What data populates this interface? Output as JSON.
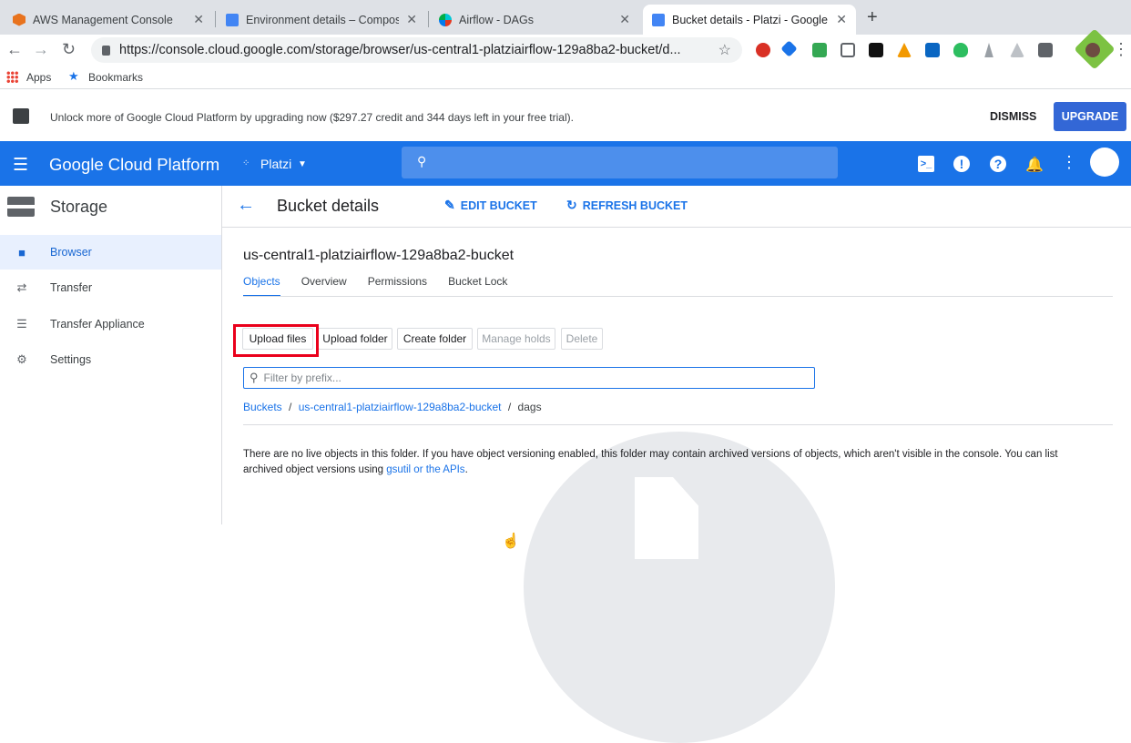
{
  "browser": {
    "tabs": [
      {
        "title": "AWS Management Console"
      },
      {
        "title": "Environment details – Composer"
      },
      {
        "title": "Airflow - DAGs"
      },
      {
        "title": "Bucket details - Platzi - Google Cloud Platform"
      }
    ],
    "url": "https://console.cloud.google.com/storage/browser/us-central1-platziairflow-129a8ba2-bucket/d...",
    "bookmarks": {
      "apps": "Apps",
      "bookmarks": "Bookmarks"
    }
  },
  "banner": {
    "message": "Unlock more of Google Cloud Platform by upgrading now ($297.27 credit and 344 days left in your free trial).",
    "dismiss": "DISMISS",
    "upgrade": "UPGRADE"
  },
  "header": {
    "brand": "Google Cloud Platform",
    "project": "Platzi"
  },
  "sidebar": {
    "title": "Storage",
    "items": [
      {
        "label": "Browser",
        "icon": "bucket-icon"
      },
      {
        "label": "Transfer",
        "icon": "transfer-icon"
      },
      {
        "label": "Transfer Appliance",
        "icon": "list-icon"
      },
      {
        "label": "Settings",
        "icon": "gear-icon"
      }
    ]
  },
  "main": {
    "page_title": "Bucket details",
    "edit_bucket": "EDIT BUCKET",
    "refresh_bucket": "REFRESH BUCKET",
    "bucket_name": "us-central1-platziairflow-129a8ba2-bucket",
    "tabs": [
      "Objects",
      "Overview",
      "Permissions",
      "Bucket Lock"
    ],
    "actions": {
      "upload_files": "Upload files",
      "upload_folder": "Upload folder",
      "create_folder": "Create folder",
      "manage_holds": "Manage holds",
      "delete": "Delete"
    },
    "filter_placeholder": "Filter by prefix...",
    "breadcrumbs": {
      "root": "Buckets",
      "bucket": "us-central1-platziairflow-129a8ba2-bucket",
      "folder": "dags",
      "sep": "/"
    },
    "empty_text": "There are no live objects in this folder. If you have object versioning enabled, this folder may contain archived versions of objects, which aren't visible in the console. You can list archived object versions using",
    "empty_link": "gsutil or the APIs",
    "empty_end": "."
  },
  "colors": {
    "accent": "#1a73e8",
    "highlight": "#ea001b"
  }
}
